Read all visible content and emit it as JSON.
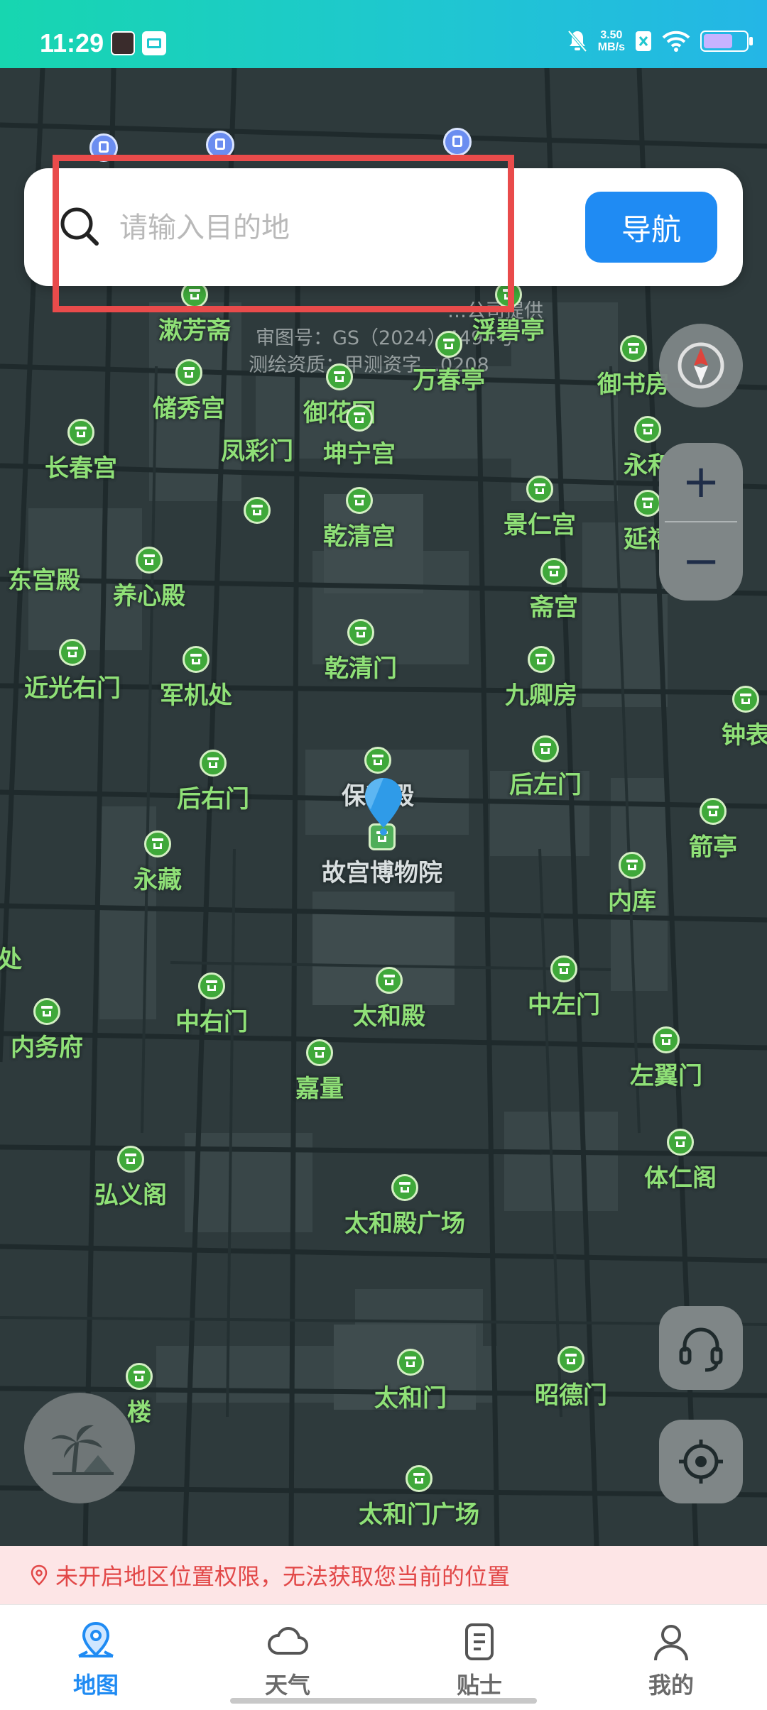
{
  "status_bar": {
    "time": "11:29",
    "net_speed_value": "3.50",
    "net_speed_unit": "MB/s",
    "icons": [
      "notification-icon",
      "wallet-icon",
      "mute-icon",
      "sim-icon",
      "wifi-icon",
      "battery-icon"
    ]
  },
  "search": {
    "placeholder": "请输入目的地",
    "nav_label": "导航"
  },
  "map": {
    "credits": [
      "…公司提供",
      "审图号：GS（2024）4494号",
      "测绘资质：甲测资字…0208"
    ],
    "pois": [
      {
        "name": "漱芳斋"
      },
      {
        "name": "御花园"
      },
      {
        "name": "万春亭"
      },
      {
        "name": "浮碧亭"
      },
      {
        "name": "储秀宫"
      },
      {
        "name": "御书房"
      },
      {
        "name": "长春宫"
      },
      {
        "name": "坤宁宫"
      },
      {
        "name": "凤彩门"
      },
      {
        "name": "永和"
      },
      {
        "name": "乾清宫"
      },
      {
        "name": "景仁宫"
      },
      {
        "name": "延禧"
      },
      {
        "name": "东宫殿"
      },
      {
        "name": "养心殿"
      },
      {
        "name": "斋宫"
      },
      {
        "name": "乾清门"
      },
      {
        "name": "近光右门"
      },
      {
        "name": "军机处"
      },
      {
        "name": "九卿房"
      },
      {
        "name": "钟表"
      },
      {
        "name": "保和殿"
      },
      {
        "name": "后右门"
      },
      {
        "name": "后左门"
      },
      {
        "name": "箭亭"
      },
      {
        "name": "永藏"
      },
      {
        "name": "故宫博物院"
      },
      {
        "name": "内库"
      },
      {
        "name": "处"
      },
      {
        "name": "中右门"
      },
      {
        "name": "太和殿"
      },
      {
        "name": "中左门"
      },
      {
        "name": "内务府"
      },
      {
        "name": "嘉量"
      },
      {
        "name": "左翼门"
      },
      {
        "name": "体仁阁"
      },
      {
        "name": "弘义阁"
      },
      {
        "name": "太和殿广场"
      },
      {
        "name": "太和门"
      },
      {
        "name": "昭德门"
      },
      {
        "name": "楼"
      },
      {
        "name": "太和门广场"
      }
    ]
  },
  "controls": {
    "zoom_in": "+",
    "zoom_out": "−"
  },
  "location_warning": "未开启地区位置权限，无法获取您当前的位置",
  "tabs": [
    {
      "label": "地图",
      "icon": "map-pin-icon",
      "active": true
    },
    {
      "label": "天气",
      "icon": "cloud-icon",
      "active": false
    },
    {
      "label": "贴士",
      "icon": "tips-icon",
      "active": false
    },
    {
      "label": "我的",
      "icon": "user-icon",
      "active": false
    }
  ],
  "colors": {
    "accent": "#1f8bf3",
    "poi_label": "#8fe077",
    "poi_icon": "#3fa83a",
    "warning_text": "#e24848",
    "warning_bg": "#fde5e6",
    "highlight_box": "#e94b4b",
    "map_bg": "#2e3a3c"
  }
}
